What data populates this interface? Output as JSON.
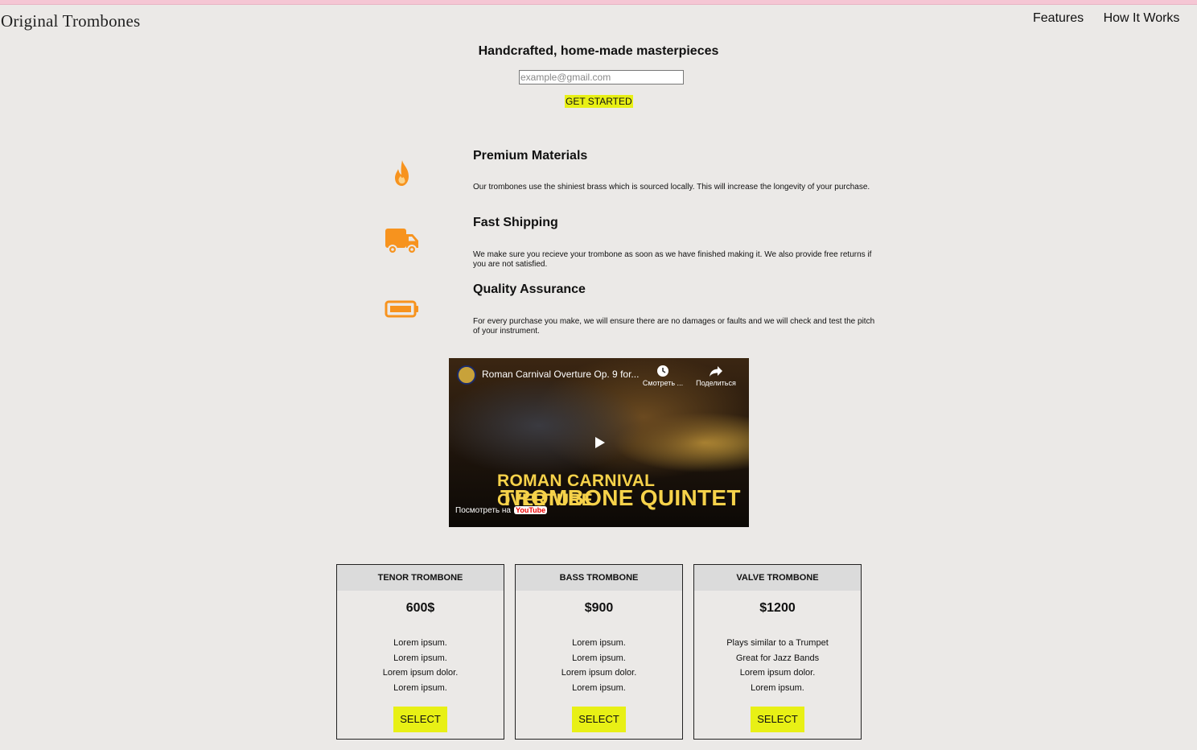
{
  "brand": "Original Trombones",
  "nav": [
    "Features",
    "How It Works",
    "P"
  ],
  "hero": {
    "title": "Handcrafted, home-made masterpieces",
    "email_placeholder": "example@gmail.com",
    "cta": "GET STARTED"
  },
  "features": [
    {
      "icon": "fire-icon",
      "title": "Premium Materials",
      "text": "Our trombones use the shiniest brass which is sourced locally. This will increase the longevity of your purchase."
    },
    {
      "icon": "truck-icon",
      "title": "Fast Shipping",
      "text": "We make sure you recieve your trombone as soon as we have finished making it. We also provide free returns if you are not satisfied."
    },
    {
      "icon": "battery-icon",
      "title": "Quality Assurance",
      "text": "For every purchase you make, we will ensure there are no damages or faults and we will check and test the pitch of your instrument."
    }
  ],
  "video": {
    "title": "Roman Carnival Overture Op. 9 for...",
    "watch_later": "Смотреть ...",
    "share": "Поделиться",
    "overlay_line1": "ROMAN CARNIVAL OVERTURE",
    "overlay_line2": "TROMBONE QUINTET",
    "watch_on": "Посмотреть на",
    "youtube": "YouTube"
  },
  "plans": [
    {
      "name": "TENOR TROMBONE",
      "price": "600$",
      "features": [
        "Lorem ipsum.",
        "Lorem ipsum.",
        "Lorem ipsum dolor.",
        "Lorem ipsum."
      ],
      "button": "SELECT"
    },
    {
      "name": "BASS TROMBONE",
      "price": "$900",
      "features": [
        "Lorem ipsum.",
        "Lorem ipsum.",
        "Lorem ipsum dolor.",
        "Lorem ipsum."
      ],
      "button": "SELECT"
    },
    {
      "name": "VALVE TROMBONE",
      "price": "$1200",
      "features": [
        "Plays similar to a Trumpet",
        "Great for Jazz Bands",
        "Lorem ipsum dolor.",
        "Lorem ipsum."
      ],
      "button": "SELECT"
    }
  ],
  "colors": {
    "accent": "#e8f015",
    "icon": "#f7931e",
    "background": "#ebe9e7"
  }
}
